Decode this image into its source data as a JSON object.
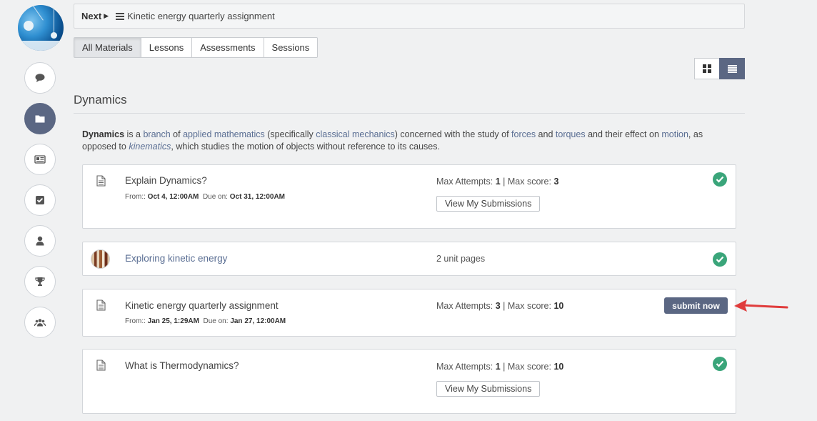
{
  "nav": {
    "next_label": "Next",
    "next_item": "Kinetic energy quarterly assignment"
  },
  "tabs": [
    {
      "label": "All Materials",
      "active": true
    },
    {
      "label": "Lessons",
      "active": false
    },
    {
      "label": "Assessments",
      "active": false
    },
    {
      "label": "Sessions",
      "active": false
    }
  ],
  "view_toggle": {
    "grid_icon": "grid-icon",
    "list_icon": "list-icon",
    "active": "list"
  },
  "sidebar": {
    "icons": [
      "chat-icon",
      "folder-icon",
      "newspaper-icon",
      "checkbox-icon",
      "user-icon",
      "trophy-icon",
      "users-icon"
    ],
    "active": "folder-icon"
  },
  "section": {
    "title": "Dynamics",
    "desc": {
      "w1": "Dynamics",
      "t1": " is a ",
      "l1": "branch",
      "t2": " of ",
      "l2": "applied mathematics",
      "t3": " (specifically ",
      "l3": "classical mechanics",
      "t4": ") concerned with the study of ",
      "l4": "forces",
      "t5": " and ",
      "l5": "torques",
      "t6": " and their effect on ",
      "l6": "motion",
      "t7": ", as opposed to ",
      "l7": "kinematics",
      "t8": ", which studies the motion of objects without reference to its causes."
    }
  },
  "cards": [
    {
      "title": "Explain Dynamics?",
      "from_label": "From::",
      "from": "Oct 4, 12:00AM",
      "due_label": "Due on:",
      "due": "Oct 31, 12:00AM",
      "attempts_label": "Max Attempts:",
      "attempts": "1",
      "score_label": "Max score:",
      "score": "3",
      "button": "View My Submissions",
      "completed": true
    },
    {
      "title": "Exploring kinetic energy",
      "meta": "2 unit pages",
      "completed": true
    },
    {
      "title": "Kinetic energy quarterly assignment",
      "from_label": "From::",
      "from": "Jan 25, 1:29AM",
      "due_label": "Due on:",
      "due": "Jan 27, 12:00AM",
      "attempts_label": "Max Attempts:",
      "attempts": "3",
      "score_label": "Max score:",
      "score": "10",
      "button": "submit now",
      "completed": false
    },
    {
      "title": "What is Thermodynamics?",
      "attempts_label": "Max Attempts:",
      "attempts": "1",
      "score_label": "Max score:",
      "score": "10",
      "button": "View My Submissions",
      "completed": true
    }
  ],
  "sep": "|",
  "colors": {
    "accent": "#5b6783",
    "success": "#3aa57a",
    "arrow": "#e03c3c",
    "link": "#5a6e93"
  }
}
